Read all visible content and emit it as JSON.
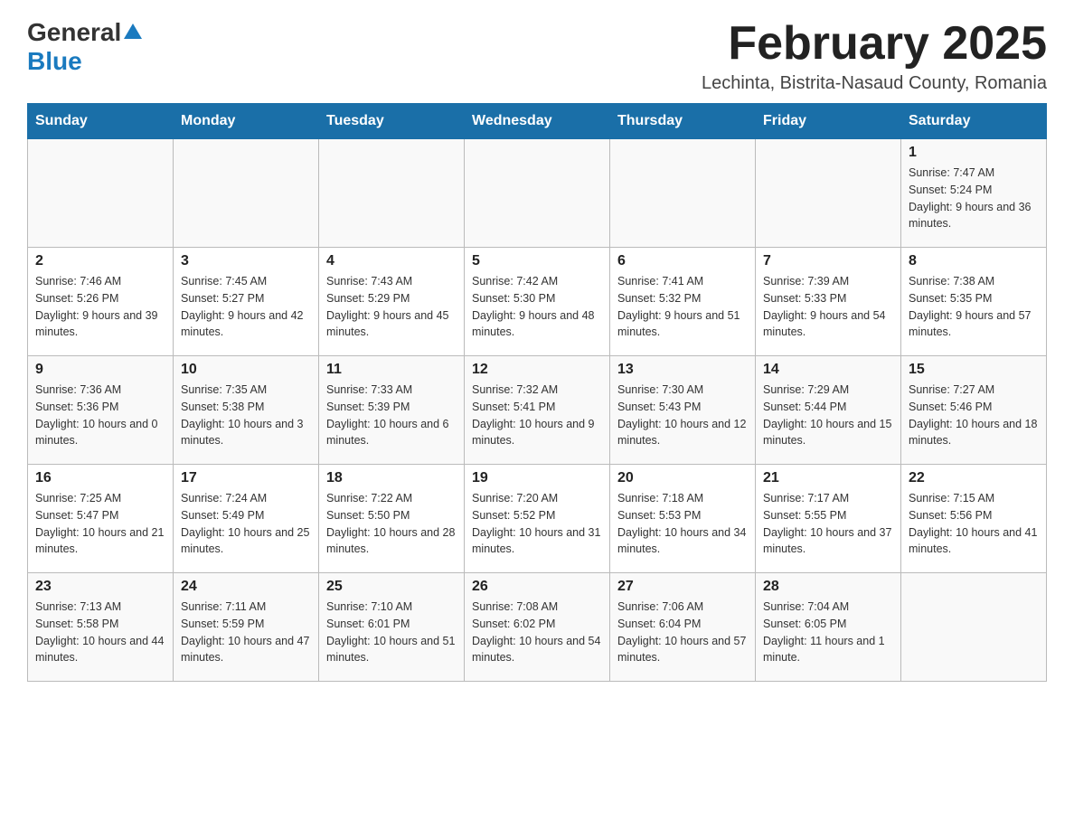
{
  "header": {
    "title": "February 2025",
    "subtitle": "Lechinta, Bistrita-Nasaud County, Romania",
    "logo_general": "General",
    "logo_blue": "Blue"
  },
  "calendar": {
    "days_of_week": [
      "Sunday",
      "Monday",
      "Tuesday",
      "Wednesday",
      "Thursday",
      "Friday",
      "Saturday"
    ],
    "weeks": [
      [
        {
          "day": "",
          "info": ""
        },
        {
          "day": "",
          "info": ""
        },
        {
          "day": "",
          "info": ""
        },
        {
          "day": "",
          "info": ""
        },
        {
          "day": "",
          "info": ""
        },
        {
          "day": "",
          "info": ""
        },
        {
          "day": "1",
          "info": "Sunrise: 7:47 AM\nSunset: 5:24 PM\nDaylight: 9 hours and 36 minutes."
        }
      ],
      [
        {
          "day": "2",
          "info": "Sunrise: 7:46 AM\nSunset: 5:26 PM\nDaylight: 9 hours and 39 minutes."
        },
        {
          "day": "3",
          "info": "Sunrise: 7:45 AM\nSunset: 5:27 PM\nDaylight: 9 hours and 42 minutes."
        },
        {
          "day": "4",
          "info": "Sunrise: 7:43 AM\nSunset: 5:29 PM\nDaylight: 9 hours and 45 minutes."
        },
        {
          "day": "5",
          "info": "Sunrise: 7:42 AM\nSunset: 5:30 PM\nDaylight: 9 hours and 48 minutes."
        },
        {
          "day": "6",
          "info": "Sunrise: 7:41 AM\nSunset: 5:32 PM\nDaylight: 9 hours and 51 minutes."
        },
        {
          "day": "7",
          "info": "Sunrise: 7:39 AM\nSunset: 5:33 PM\nDaylight: 9 hours and 54 minutes."
        },
        {
          "day": "8",
          "info": "Sunrise: 7:38 AM\nSunset: 5:35 PM\nDaylight: 9 hours and 57 minutes."
        }
      ],
      [
        {
          "day": "9",
          "info": "Sunrise: 7:36 AM\nSunset: 5:36 PM\nDaylight: 10 hours and 0 minutes."
        },
        {
          "day": "10",
          "info": "Sunrise: 7:35 AM\nSunset: 5:38 PM\nDaylight: 10 hours and 3 minutes."
        },
        {
          "day": "11",
          "info": "Sunrise: 7:33 AM\nSunset: 5:39 PM\nDaylight: 10 hours and 6 minutes."
        },
        {
          "day": "12",
          "info": "Sunrise: 7:32 AM\nSunset: 5:41 PM\nDaylight: 10 hours and 9 minutes."
        },
        {
          "day": "13",
          "info": "Sunrise: 7:30 AM\nSunset: 5:43 PM\nDaylight: 10 hours and 12 minutes."
        },
        {
          "day": "14",
          "info": "Sunrise: 7:29 AM\nSunset: 5:44 PM\nDaylight: 10 hours and 15 minutes."
        },
        {
          "day": "15",
          "info": "Sunrise: 7:27 AM\nSunset: 5:46 PM\nDaylight: 10 hours and 18 minutes."
        }
      ],
      [
        {
          "day": "16",
          "info": "Sunrise: 7:25 AM\nSunset: 5:47 PM\nDaylight: 10 hours and 21 minutes."
        },
        {
          "day": "17",
          "info": "Sunrise: 7:24 AM\nSunset: 5:49 PM\nDaylight: 10 hours and 25 minutes."
        },
        {
          "day": "18",
          "info": "Sunrise: 7:22 AM\nSunset: 5:50 PM\nDaylight: 10 hours and 28 minutes."
        },
        {
          "day": "19",
          "info": "Sunrise: 7:20 AM\nSunset: 5:52 PM\nDaylight: 10 hours and 31 minutes."
        },
        {
          "day": "20",
          "info": "Sunrise: 7:18 AM\nSunset: 5:53 PM\nDaylight: 10 hours and 34 minutes."
        },
        {
          "day": "21",
          "info": "Sunrise: 7:17 AM\nSunset: 5:55 PM\nDaylight: 10 hours and 37 minutes."
        },
        {
          "day": "22",
          "info": "Sunrise: 7:15 AM\nSunset: 5:56 PM\nDaylight: 10 hours and 41 minutes."
        }
      ],
      [
        {
          "day": "23",
          "info": "Sunrise: 7:13 AM\nSunset: 5:58 PM\nDaylight: 10 hours and 44 minutes."
        },
        {
          "day": "24",
          "info": "Sunrise: 7:11 AM\nSunset: 5:59 PM\nDaylight: 10 hours and 47 minutes."
        },
        {
          "day": "25",
          "info": "Sunrise: 7:10 AM\nSunset: 6:01 PM\nDaylight: 10 hours and 51 minutes."
        },
        {
          "day": "26",
          "info": "Sunrise: 7:08 AM\nSunset: 6:02 PM\nDaylight: 10 hours and 54 minutes."
        },
        {
          "day": "27",
          "info": "Sunrise: 7:06 AM\nSunset: 6:04 PM\nDaylight: 10 hours and 57 minutes."
        },
        {
          "day": "28",
          "info": "Sunrise: 7:04 AM\nSunset: 6:05 PM\nDaylight: 11 hours and 1 minute."
        },
        {
          "day": "",
          "info": ""
        }
      ]
    ]
  }
}
